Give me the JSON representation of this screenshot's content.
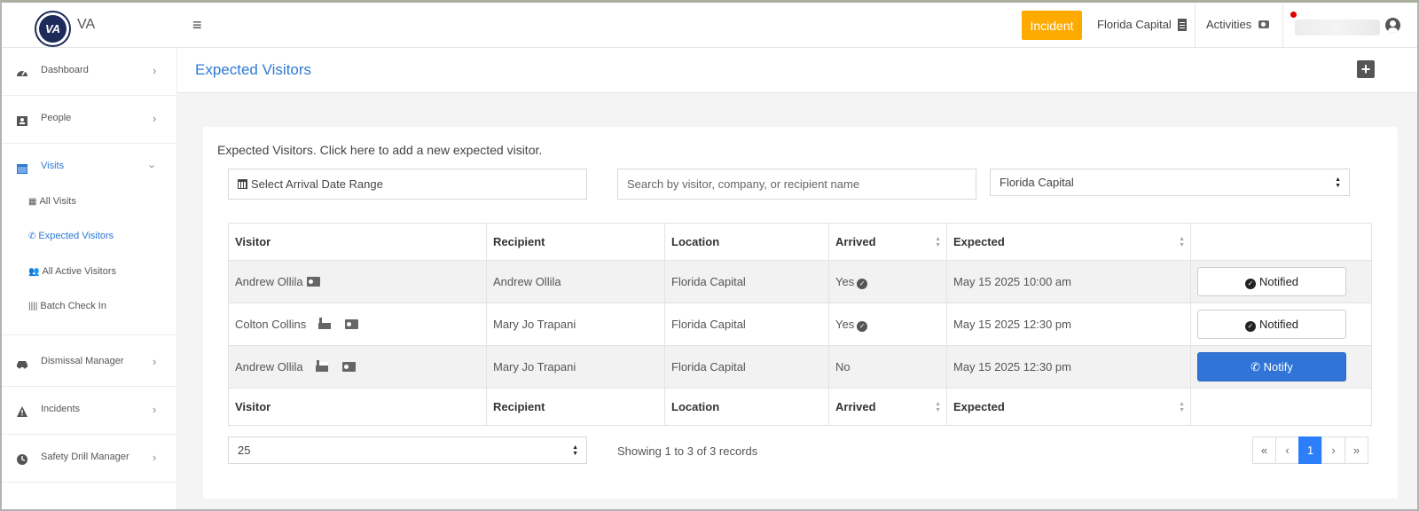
{
  "app": {
    "brand": "VA",
    "logo_text": "VA"
  },
  "topbar": {
    "incident_label": "Incident",
    "location": "Florida Capital",
    "activities": "Activities",
    "colors": {
      "incident": "#ffaa00",
      "notif_dot": "#e00000"
    }
  },
  "sidebar": {
    "items": [
      {
        "label": "Dashboard",
        "icon": "gauge-icon"
      },
      {
        "label": "People",
        "icon": "id-badge-icon"
      },
      {
        "label": "Visits",
        "icon": "calendar-icon",
        "active": true
      },
      {
        "label": "Dismissal Manager",
        "icon": "car-icon"
      },
      {
        "label": "Incidents",
        "icon": "warning-icon"
      },
      {
        "label": "Safety Drill Manager",
        "icon": "clock-icon"
      }
    ],
    "sub_items": [
      {
        "label": "All Visits",
        "icon": "calendar-icon"
      },
      {
        "label": "Expected Visitors",
        "icon": "phone-icon",
        "active": true
      },
      {
        "label": "All Active Visitors",
        "icon": "users-icon"
      },
      {
        "label": "Batch Check In",
        "icon": "barcode-icon"
      }
    ]
  },
  "page": {
    "title": "Expected Visitors",
    "description": "Expected Visitors. Click here to add a new expected visitor."
  },
  "filters": {
    "date_range_label": "Select Arrival Date Range",
    "search_placeholder": "Search by visitor, company, or recipient name",
    "location_selected": "Florida Capital"
  },
  "table": {
    "headers": [
      "Visitor",
      "Recipient",
      "Location",
      "Arrived",
      "Expected",
      ""
    ],
    "rows": [
      {
        "visitor": "Andrew Ollila",
        "recipient": "Andrew Ollila",
        "location": "Florida Capital",
        "arrived": "Yes",
        "expected": "May 15 2025 10:00 am",
        "action": "Notified"
      },
      {
        "visitor": "Colton Collins",
        "recipient": "Mary Jo Trapani",
        "location": "Florida Capital",
        "arrived": "Yes",
        "expected": "May 15 2025 12:30 pm",
        "action": "Notified"
      },
      {
        "visitor": "Andrew Ollila",
        "recipient": "Mary Jo Trapani",
        "location": "Florida Capital",
        "arrived": "No",
        "expected": "May 15 2025 12:30 pm",
        "action": "Notify"
      }
    ]
  },
  "footer": {
    "page_size": "25",
    "showing": "Showing 1 to 3 of 3 records",
    "pager": {
      "first": "«",
      "prev": "‹",
      "current": "1",
      "next": "›",
      "last": "»"
    }
  }
}
